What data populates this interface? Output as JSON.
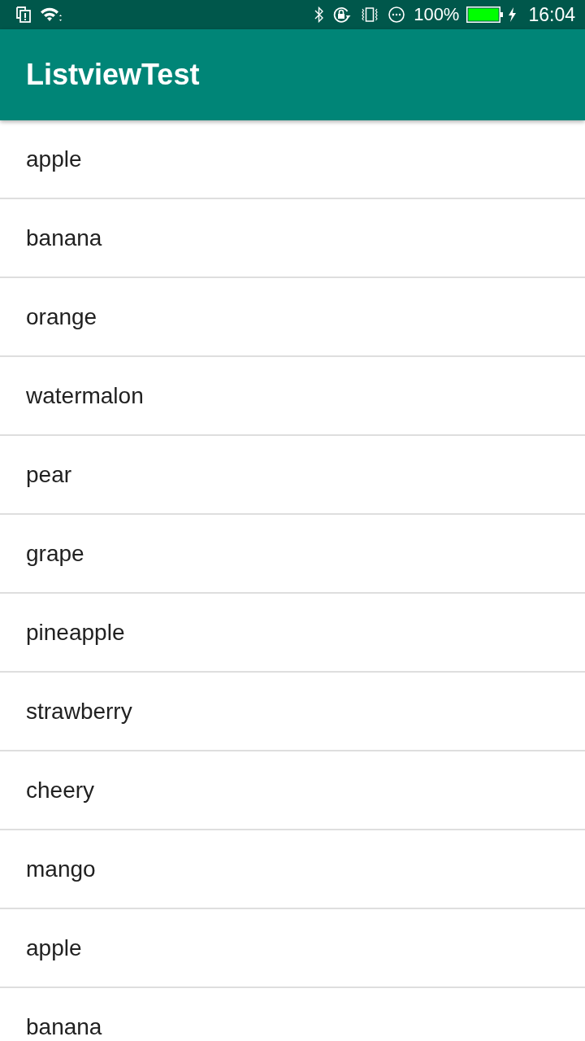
{
  "status_bar": {
    "battery_percent": "100%",
    "time": "16:04"
  },
  "app_bar": {
    "title": "ListviewTest"
  },
  "list": {
    "items": [
      "apple",
      "banana",
      "orange",
      "watermalon",
      "pear",
      "grape",
      "pineapple",
      "strawberry",
      "cheery",
      "mango",
      "apple",
      "banana"
    ]
  }
}
